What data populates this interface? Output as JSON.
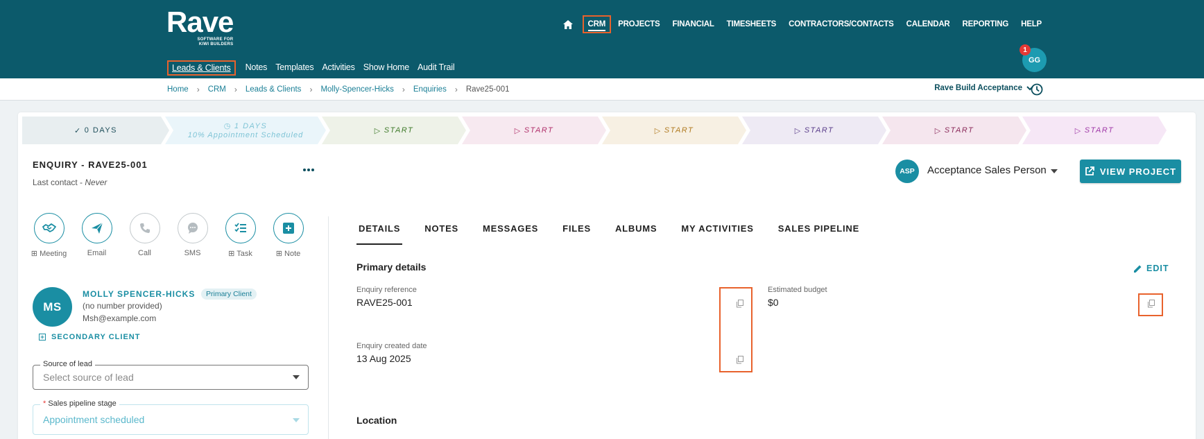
{
  "header": {
    "logo_word": "Rave",
    "logo_tagline_1": "SOFTWARE FOR",
    "logo_tagline_2": "KIWI BUILDERS",
    "nav": [
      "CRM",
      "PROJECTS",
      "FINANCIAL",
      "TIMESHEETS",
      "CONTRACTORS/CONTACTS",
      "CALENDAR",
      "REPORTING",
      "HELP"
    ],
    "active_nav": "CRM",
    "subnav": [
      "Leads & Clients",
      "Notes",
      "Templates",
      "Activities",
      "Show Home",
      "Audit Trail"
    ],
    "active_subnav": "Leads & Clients",
    "user_initials": "GG",
    "notification_count": "1"
  },
  "breadcrumb": [
    "Home",
    "CRM",
    "Leads & Clients",
    "Molly-Spencer-Hicks",
    "Enquiries",
    "Rave25-001"
  ],
  "company": "Rave Build Acceptance",
  "pipeline": [
    {
      "icon": "✓",
      "label": "0 DAYS",
      "sub": "",
      "color": "#1e4e5a",
      "bg": "#e8eef0"
    },
    {
      "icon": "◷",
      "label": "1 DAYS",
      "sub": "10% Appointment Scheduled",
      "color": "#7fc4d6",
      "bg": "#eaf5fa"
    },
    {
      "icon": "▷",
      "label": "START",
      "sub": "",
      "color": "#3f7a2a",
      "bg": "#eef2e8"
    },
    {
      "icon": "▷",
      "label": "START",
      "sub": "",
      "color": "#b0306a",
      "bg": "#f7e9f0"
    },
    {
      "icon": "▷",
      "label": "START",
      "sub": "",
      "color": "#b07a20",
      "bg": "#f7f0e3"
    },
    {
      "icon": "▷",
      "label": "START",
      "sub": "",
      "color": "#5a3d8a",
      "bg": "#eeeaf4"
    },
    {
      "icon": "▷",
      "label": "START",
      "sub": "",
      "color": "#8a2a5a",
      "bg": "#f5e6ee"
    },
    {
      "icon": "▷",
      "label": "START",
      "sub": "",
      "color": "#a03aa8",
      "bg": "#f6e7f6"
    }
  ],
  "enquiry": {
    "title": "ENQUIRY - RAVE25-001",
    "last_contact_label": "Last contact - ",
    "last_contact_value": "Never"
  },
  "actions": [
    {
      "label": "Meeting",
      "prefix": "⊞ ",
      "icon": "handshake-icon",
      "active": true
    },
    {
      "label": "Email",
      "prefix": "",
      "icon": "send-icon",
      "active": true
    },
    {
      "label": "Call",
      "prefix": "",
      "icon": "phone-icon",
      "active": false
    },
    {
      "label": "SMS",
      "prefix": "",
      "icon": "chat-icon",
      "active": false
    },
    {
      "label": "Task",
      "prefix": "⊞ ",
      "icon": "checklist-icon",
      "active": true
    },
    {
      "label": "Note",
      "prefix": "⊞ ",
      "icon": "note-add-icon",
      "active": true
    }
  ],
  "client": {
    "initials": "MS",
    "name": "MOLLY SPENCER-HICKS",
    "tag": "Primary Client",
    "phone": "(no number provided)",
    "email": "Msh@example.com",
    "secondary_label": "SECONDARY CLIENT"
  },
  "fields": {
    "source_label": "Source of lead",
    "source_placeholder": "Select source of lead",
    "stage_required": "*",
    "stage_label": " Sales pipeline stage",
    "stage_value": "Appointment scheduled"
  },
  "assignee": {
    "initials": "ASP",
    "name": "Acceptance Sales Person"
  },
  "view_project_label": "VIEW PROJECT",
  "tabs": [
    "DETAILS",
    "NOTES",
    "MESSAGES",
    "FILES",
    "ALBUMS",
    "MY ACTIVITIES",
    "SALES PIPELINE"
  ],
  "active_tab": "DETAILS",
  "primary_details": {
    "title": "Primary details",
    "edit_label": "EDIT",
    "enquiry_reference_label": "Enquiry reference",
    "enquiry_reference_value": "RAVE25-001",
    "estimated_budget_label": "Estimated budget",
    "estimated_budget_value": "$0",
    "created_date_label": "Enquiry created date",
    "created_date_value": "13 Aug 2025"
  },
  "location_title": "Location",
  "colors": {
    "header": "#0c5a6b",
    "accent": "#1a8ea3",
    "highlight": "#e8622c"
  }
}
